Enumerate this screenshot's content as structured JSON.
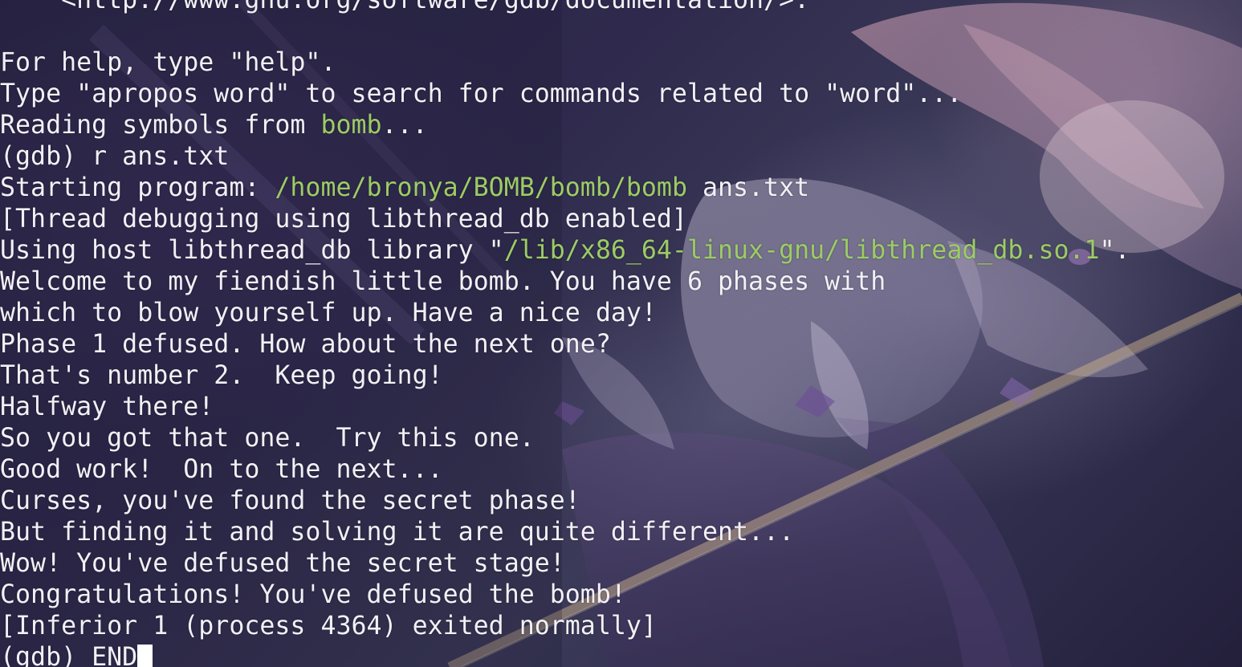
{
  "terminal": {
    "highlight_color": "#9ccc65",
    "text_color": "#f2f0f5",
    "lines": [
      {
        "segments": [
          {
            "text": "    <http://www.gnu.org/software/gdb/documentation/>."
          }
        ]
      },
      {
        "segments": [
          {
            "text": ""
          }
        ]
      },
      {
        "segments": [
          {
            "text": "For help, type \"help\"."
          }
        ]
      },
      {
        "segments": [
          {
            "text": "Type \"apropos word\" to search for commands related to \"word\"..."
          }
        ]
      },
      {
        "segments": [
          {
            "text": "Reading symbols from "
          },
          {
            "text": "bomb",
            "hl": true
          },
          {
            "text": "..."
          }
        ]
      },
      {
        "segments": [
          {
            "text": "(gdb) r ans.txt"
          }
        ]
      },
      {
        "segments": [
          {
            "text": "Starting program: "
          },
          {
            "text": "/home/bronya/BOMB/bomb/bomb",
            "hl": true
          },
          {
            "text": " ans.txt"
          }
        ]
      },
      {
        "segments": [
          {
            "text": "[Thread debugging using libthread_db enabled]"
          }
        ]
      },
      {
        "segments": [
          {
            "text": "Using host libthread_db library \""
          },
          {
            "text": "/lib/x86_64-linux-gnu/libthread_db.so.1",
            "hl": true
          },
          {
            "text": "\"."
          }
        ]
      },
      {
        "segments": [
          {
            "text": "Welcome to my fiendish little bomb. You have 6 phases with"
          }
        ]
      },
      {
        "segments": [
          {
            "text": "which to blow yourself up. Have a nice day!"
          }
        ]
      },
      {
        "segments": [
          {
            "text": "Phase 1 defused. How about the next one?"
          }
        ]
      },
      {
        "segments": [
          {
            "text": "That's number 2.  Keep going!"
          }
        ]
      },
      {
        "segments": [
          {
            "text": "Halfway there!"
          }
        ]
      },
      {
        "segments": [
          {
            "text": "So you got that one.  Try this one."
          }
        ]
      },
      {
        "segments": [
          {
            "text": "Good work!  On to the next..."
          }
        ]
      },
      {
        "segments": [
          {
            "text": "Curses, you've found the secret phase!"
          }
        ]
      },
      {
        "segments": [
          {
            "text": "But finding it and solving it are quite different..."
          }
        ]
      },
      {
        "segments": [
          {
            "text": "Wow! You've defused the secret stage!"
          }
        ]
      },
      {
        "segments": [
          {
            "text": "Congratulations! You've defused the bomb!"
          }
        ]
      },
      {
        "segments": [
          {
            "text": "[Inferior 1 (process 4364) exited normally]"
          }
        ]
      },
      {
        "segments": [
          {
            "text": "(gdb) END"
          }
        ],
        "cursor": true
      }
    ]
  }
}
